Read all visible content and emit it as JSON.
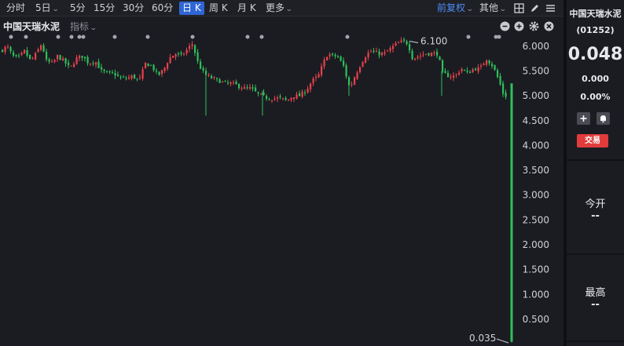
{
  "toolbar": {
    "intraday": "分时",
    "five_day": "5日",
    "m5": "5分",
    "m15": "15分",
    "m30": "30分",
    "m60": "60分",
    "daily": "日 K",
    "weekly": "周 K",
    "monthly": "月 K",
    "more": "更多",
    "adjust": "前复权",
    "other": "其他"
  },
  "chart_header": {
    "stock_name": "中国天瑞水泥",
    "indicator": "指标"
  },
  "sidebar": {
    "name": "中国天瑞水泥",
    "code": "(01252)",
    "price": "0.048",
    "change": "0.000",
    "change_pct": "0.00%",
    "trade_label": "交易",
    "open_label": "今开",
    "open_value": "--",
    "high_label": "最高",
    "high_value": "--"
  },
  "colors": {
    "up": "#e8414b",
    "down": "#2fc05a",
    "accent": "#2f66d6",
    "background": "#1b1c22"
  },
  "chart_data": {
    "type": "candlestick",
    "y_ticks": [
      "6.000",
      "5.500",
      "5.000",
      "4.500",
      "4.000",
      "3.500",
      "3.000",
      "2.500",
      "2.000",
      "1.500",
      "1.000",
      "0.500"
    ],
    "ylim": [
      0,
      6.25
    ],
    "annotations": {
      "max_label": "6.100",
      "min_label": "0.035"
    },
    "event_marker_count": 15,
    "close_path": [
      [
        0,
        5.9
      ],
      [
        8,
        6.0
      ],
      [
        15,
        5.8
      ],
      [
        22,
        5.75
      ],
      [
        30,
        5.9
      ],
      [
        38,
        5.7
      ],
      [
        45,
        5.85
      ],
      [
        52,
        6.05
      ],
      [
        58,
        5.7
      ],
      [
        66,
        5.65
      ],
      [
        72,
        5.8
      ],
      [
        80,
        5.7
      ],
      [
        88,
        5.55
      ],
      [
        96,
        5.75
      ],
      [
        104,
        5.8
      ],
      [
        112,
        5.65
      ],
      [
        120,
        5.7
      ],
      [
        128,
        5.5
      ],
      [
        136,
        5.45
      ],
      [
        144,
        5.45
      ],
      [
        152,
        5.35
      ],
      [
        160,
        5.35
      ],
      [
        168,
        5.4
      ],
      [
        176,
        5.3
      ],
      [
        184,
        5.65
      ],
      [
        192,
        5.6
      ],
      [
        200,
        5.4
      ],
      [
        208,
        5.55
      ],
      [
        214,
        5.75
      ],
      [
        222,
        5.85
      ],
      [
        230,
        5.8
      ],
      [
        238,
        5.95
      ],
      [
        244,
        6.05
      ],
      [
        250,
        5.7
      ],
      [
        256,
        5.5
      ],
      [
        262,
        5.4
      ],
      [
        270,
        5.35
      ],
      [
        278,
        5.3
      ],
      [
        286,
        5.25
      ],
      [
        294,
        5.25
      ],
      [
        302,
        5.2
      ],
      [
        310,
        5.15
      ],
      [
        318,
        5.15
      ],
      [
        326,
        5.05
      ],
      [
        332,
        5.0
      ],
      [
        340,
        4.95
      ],
      [
        348,
        4.95
      ],
      [
        356,
        4.95
      ],
      [
        364,
        4.9
      ],
      [
        372,
        5.0
      ],
      [
        380,
        5.0
      ],
      [
        388,
        5.1
      ],
      [
        396,
        5.3
      ],
      [
        404,
        5.4
      ],
      [
        410,
        5.65
      ],
      [
        416,
        5.85
      ],
      [
        422,
        5.8
      ],
      [
        428,
        5.8
      ],
      [
        436,
        5.6
      ],
      [
        444,
        5.15
      ],
      [
        452,
        5.45
      ],
      [
        460,
        5.7
      ],
      [
        466,
        5.85
      ],
      [
        472,
        5.9
      ],
      [
        480,
        5.85
      ],
      [
        488,
        5.85
      ],
      [
        496,
        5.95
      ],
      [
        504,
        6.05
      ],
      [
        512,
        6.1
      ],
      [
        518,
        6.05
      ],
      [
        524,
        5.75
      ],
      [
        532,
        5.8
      ],
      [
        540,
        5.85
      ],
      [
        548,
        5.85
      ],
      [
        556,
        5.85
      ],
      [
        562,
        5.45
      ],
      [
        570,
        5.4
      ],
      [
        578,
        5.4
      ],
      [
        586,
        5.55
      ],
      [
        594,
        5.45
      ],
      [
        602,
        5.55
      ],
      [
        610,
        5.55
      ],
      [
        618,
        5.75
      ],
      [
        626,
        5.6
      ],
      [
        634,
        5.3
      ],
      [
        640,
        5.0
      ],
      [
        645,
        5.0
      ],
      [
        651,
        5.25
      ]
    ],
    "last_bar": {
      "open": 5.25,
      "high": 5.25,
      "low": 0.035,
      "close": 0.048
    }
  }
}
